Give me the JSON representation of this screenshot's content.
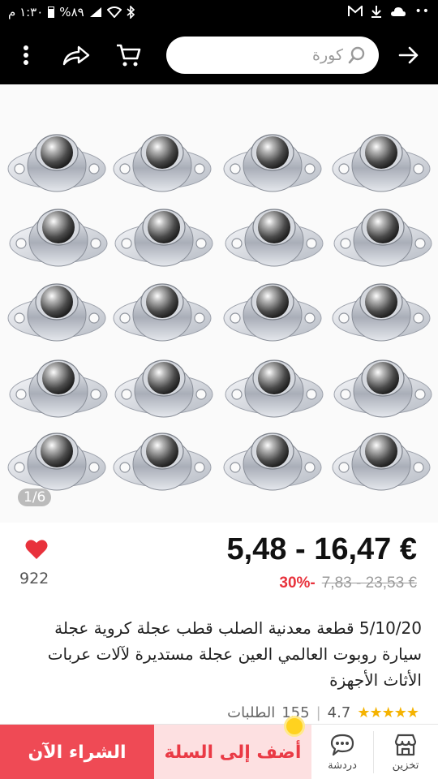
{
  "status_bar": {
    "time": "١:٣٠ م",
    "battery": "%٨٩"
  },
  "search": {
    "placeholder": "كورة"
  },
  "gallery": {
    "counter": "1/6"
  },
  "product": {
    "price_range": "5,48 - 16,47 €",
    "original_price": "7,83 - 23,53 €",
    "discount": "30%-",
    "favorites_count": "922",
    "title": "5/10/20 قطعة معدنية الصلب قطب عجلة كروية عجلة سيارة روبوت العالمي العين عجلة مستديرة لآلات عربات الأثاث الأجهزة",
    "rating": "4.7",
    "orders_count": "155",
    "orders_label": "الطلبات",
    "stars": "★★★★★"
  },
  "bottom_bar": {
    "store_label": "تخزين",
    "chat_label": "دردشة",
    "add_to_cart_label": "أضف إلى السلة",
    "buy_now_label": "الشراء الآن"
  },
  "colors": {
    "accent_red": "#ef4a55",
    "cart_bg": "#fde0e1",
    "star": "#f5b301"
  }
}
